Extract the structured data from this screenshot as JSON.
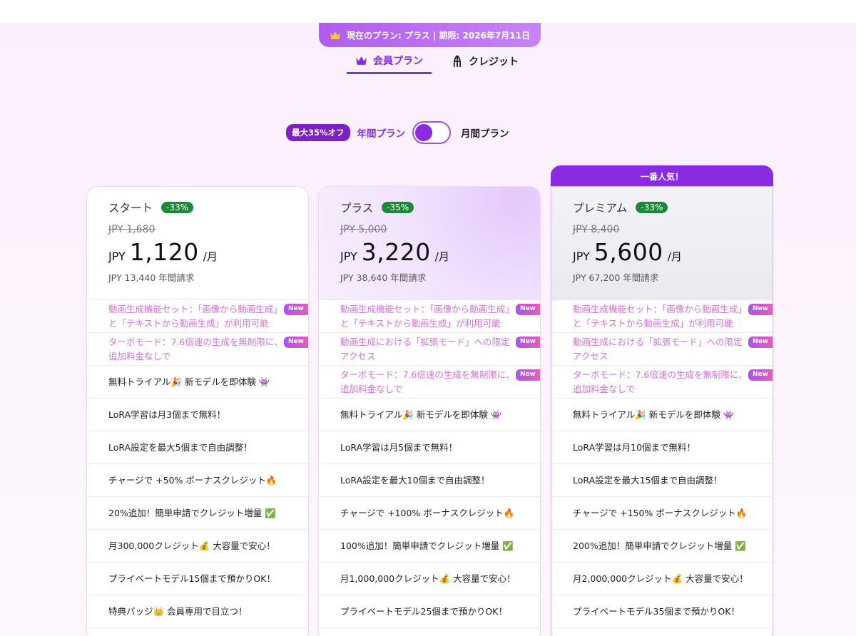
{
  "banner": {
    "text": "現在のプラン: プラス | 期限: 2026年7月11日"
  },
  "tabs": [
    {
      "label": "会員プラン",
      "active": true
    },
    {
      "label": "クレジット",
      "active": false
    }
  ],
  "billing": {
    "discount_badge": "最大35%オフ",
    "yearly_label": "年間プラン",
    "monthly_label": "月間プラン",
    "selected": "yearly"
  },
  "popular_label": "一番人気！",
  "new_badge": "New",
  "plans": [
    {
      "name": "スタート",
      "discount": "-33%",
      "old_price": "JPY 1,680",
      "currency": "JPY",
      "price": "1,120",
      "per": "/月",
      "annual": "JPY 13,440 年間請求",
      "features": [
        {
          "text": "動画生成機能セット：「画像から動画生成」と「テキストから動画生成」が利用可能",
          "new": true
        },
        {
          "text": "ターボモード：7.6倍速の生成を無制限に、追加料金なしで",
          "new": true
        },
        {
          "text": "無料トライアル🎉 新モデルを即体験 👾",
          "new": false
        },
        {
          "text": "LoRA学習は月3個まで無料！",
          "new": false
        },
        {
          "text": "LoRA設定を最大5個まで自由調整！",
          "new": false
        },
        {
          "text": "チャージで +50% ボーナスクレジット🔥",
          "new": false
        },
        {
          "text": "20%追加！簡単申請でクレジット増量 ✅",
          "new": false
        },
        {
          "text": "月300,000クレジット💰 大容量で安心！",
          "new": false
        },
        {
          "text": "プライベートモデル15個まで預かりOK！",
          "new": false
        },
        {
          "text": "特典バッジ👑 会員専用で目立つ！",
          "new": false
        }
      ]
    },
    {
      "name": "プラス",
      "discount": "-35%",
      "old_price": "JPY 5,000",
      "currency": "JPY",
      "price": "3,220",
      "per": "/月",
      "annual": "JPY 38,640 年間請求",
      "features": [
        {
          "text": "動画生成機能セット：「画像から動画生成」と「テキストから動画生成」が利用可能",
          "new": true
        },
        {
          "text": "動画生成における「拡張モード」への限定アクセス",
          "new": true
        },
        {
          "text": "ターボモード：7.6倍速の生成を無制限に、追加料金なしで",
          "new": true
        },
        {
          "text": "無料トライアル🎉 新モデルを即体験 👾",
          "new": false
        },
        {
          "text": "LoRA学習は月5個まで無料！",
          "new": false
        },
        {
          "text": "LoRA設定を最大10個まで自由調整！",
          "new": false
        },
        {
          "text": "チャージで +100% ボーナスクレジット🔥",
          "new": false
        },
        {
          "text": "100%追加！簡単申請でクレジット増量 ✅",
          "new": false
        },
        {
          "text": "月1,000,000クレジット💰 大容量で安心！",
          "new": false
        },
        {
          "text": "プライベートモデル25個まで預かりOK！",
          "new": false
        }
      ]
    },
    {
      "name": "プレミアム",
      "discount": "-33%",
      "old_price": "JPY 8,400",
      "currency": "JPY",
      "price": "5,600",
      "per": "/月",
      "annual": "JPY 67,200 年間請求",
      "features": [
        {
          "text": "動画生成機能セット：「画像から動画生成」と「テキストから動画生成」が利用可能",
          "new": true
        },
        {
          "text": "動画生成における「拡張モード」への限定アクセス",
          "new": true
        },
        {
          "text": "ターボモード：7.6倍速の生成を無制限に、追加料金なしで",
          "new": true
        },
        {
          "text": "無料トライアル🎉 新モデルを即体験 👾",
          "new": false
        },
        {
          "text": "LoRA学習は月10個まで無料！",
          "new": false
        },
        {
          "text": "LoRA設定を最大15個まで自由調整！",
          "new": false
        },
        {
          "text": "チャージで +150% ボーナスクレジット🔥",
          "new": false
        },
        {
          "text": "200%追加！簡単申請でクレジット増量 ✅",
          "new": false
        },
        {
          "text": "月2,000,000クレジット💰 大容量で安心！",
          "new": false
        },
        {
          "text": "プライベートモデル35個まで預かりOK！",
          "new": false
        }
      ]
    }
  ],
  "colors": {
    "accent": "#8a2be2",
    "discount_green": "#1a8a3a",
    "new_feature_text": "#d273d6"
  }
}
